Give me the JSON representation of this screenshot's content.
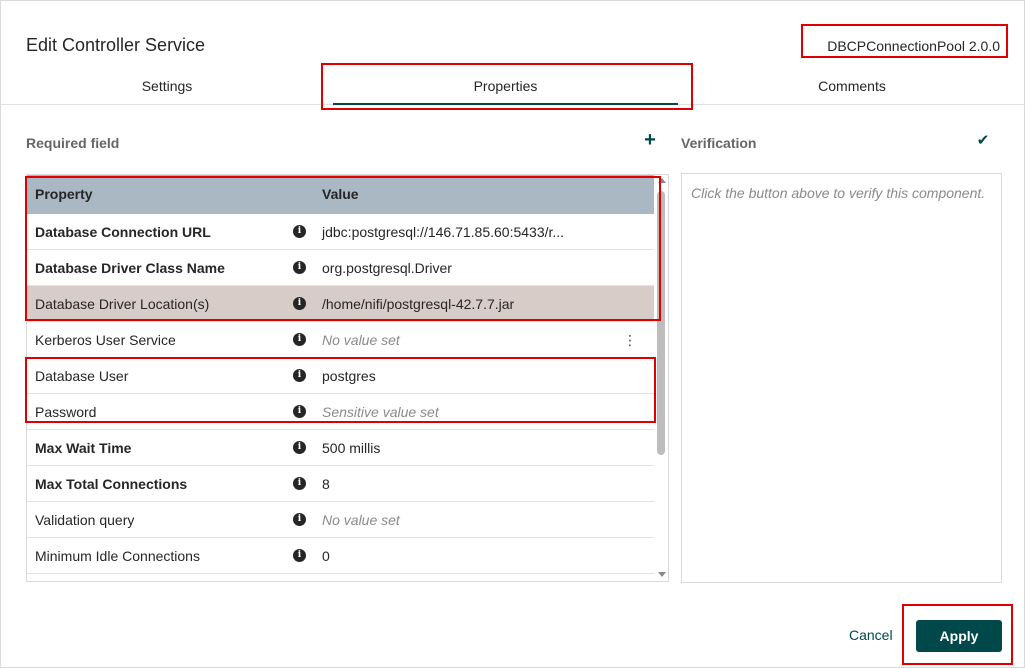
{
  "dialog": {
    "title": "Edit Controller Service",
    "version": "DBCPConnectionPool 2.0.0"
  },
  "tabs": [
    {
      "label": "Settings",
      "active": false
    },
    {
      "label": "Properties",
      "active": true
    },
    {
      "label": "Comments",
      "active": false
    }
  ],
  "required_label": "Required field",
  "verification_label": "Verification",
  "verification_text": "Click the button above to verify this component.",
  "table": {
    "headers": {
      "property": "Property",
      "value": "Value"
    },
    "rows": [
      {
        "name": "Database Connection URL",
        "value": "jdbc:postgresql://146.71.85.60:5433/r...",
        "required": true,
        "muted": false
      },
      {
        "name": "Database Driver Class Name",
        "value": "org.postgresql.Driver",
        "required": true,
        "muted": false
      },
      {
        "name": "Database Driver Location(s)",
        "value": "/home/nifi/postgresql-42.7.7.jar",
        "required": false,
        "muted": false,
        "selected": true
      },
      {
        "name": "Kerberos User Service",
        "value": "No value set",
        "required": false,
        "muted": true,
        "menu": true
      },
      {
        "name": "Database User",
        "value": "postgres",
        "required": false,
        "muted": false
      },
      {
        "name": "Password",
        "value": "Sensitive value set",
        "required": false,
        "muted": true
      },
      {
        "name": "Max Wait Time",
        "value": "500 millis",
        "required": true,
        "muted": false
      },
      {
        "name": "Max Total Connections",
        "value": "8",
        "required": true,
        "muted": false
      },
      {
        "name": "Validation query",
        "value": "No value set",
        "required": false,
        "muted": true
      },
      {
        "name": "Minimum Idle Connections",
        "value": "0",
        "required": false,
        "muted": false
      }
    ]
  },
  "buttons": {
    "cancel": "Cancel",
    "apply": "Apply"
  },
  "icons": {
    "add": "plus-icon",
    "verify": "checkmark-icon",
    "info": "info-icon",
    "menu": "kebab-menu-icon"
  },
  "colors": {
    "accent": "#004849",
    "header_bg": "#a9b8c2",
    "selected_row": "#d8ccc8",
    "highlight": "#e00000"
  }
}
